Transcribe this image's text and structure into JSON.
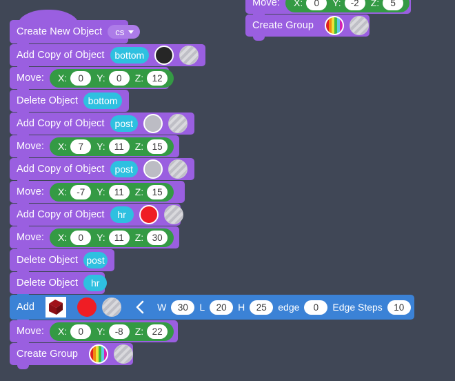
{
  "canvas": {
    "background_color": "#404756",
    "block_purple": "#9a5fe0",
    "block_blue": "#3b82d6",
    "capsule_green": "#349a44",
    "pill_cyan": "#2ec0e0"
  },
  "top_script": {
    "move": {
      "label": "Move:",
      "x_label": "X:",
      "x_value": "0",
      "y_label": "Y:",
      "y_value": "-2",
      "z_label": "Z:",
      "z_value": "5"
    },
    "create_group": {
      "label": "Create Group",
      "swatch_primary": "rainbow-swatch",
      "swatch_secondary": "striped-swatch"
    }
  },
  "main_script": {
    "create_new_object": {
      "label": "Create New Object",
      "dropdown_value": "cs",
      "dropdown_icon": "chevron-down-icon"
    },
    "rows": [
      {
        "type": "add-copy",
        "label": "Add Copy of Object",
        "object_name": "bottom",
        "swatch_primary": "black-swatch",
        "swatch_secondary": "striped-swatch"
      },
      {
        "type": "move",
        "label": "Move:",
        "x_label": "X:",
        "x_value": "0",
        "y_label": "Y:",
        "y_value": "0",
        "z_label": "Z:",
        "z_value": "12"
      },
      {
        "type": "delete",
        "label": "Delete Object",
        "object_name": "bottom"
      },
      {
        "type": "add-copy",
        "label": "Add Copy of Object",
        "object_name": "post",
        "swatch_primary": "grey-swatch",
        "swatch_secondary": "striped-swatch"
      },
      {
        "type": "move",
        "label": "Move:",
        "x_label": "X:",
        "x_value": "7",
        "y_label": "Y:",
        "y_value": "11",
        "z_label": "Z:",
        "z_value": "15"
      },
      {
        "type": "add-copy",
        "label": "Add Copy of Object",
        "object_name": "post",
        "swatch_primary": "grey-swatch",
        "swatch_secondary": "striped-swatch"
      },
      {
        "type": "move",
        "label": "Move:",
        "x_label": "X:",
        "x_value": "-7",
        "y_label": "Y:",
        "y_value": "11",
        "z_label": "Z:",
        "z_value": "15"
      },
      {
        "type": "add-copy",
        "label": "Add Copy of Object",
        "object_name": "hr",
        "swatch_primary": "red-swatch",
        "swatch_secondary": "striped-swatch"
      },
      {
        "type": "move",
        "label": "Move:",
        "x_label": "X:",
        "x_value": "0",
        "y_label": "Y:",
        "y_value": "11",
        "z_label": "Z:",
        "z_value": "30"
      },
      {
        "type": "delete",
        "label": "Delete Object",
        "object_name": "post"
      },
      {
        "type": "delete",
        "label": "Delete Object",
        "object_name": "hr"
      }
    ],
    "add_block": {
      "label": "Add",
      "shape_icon": "cube-icon",
      "swatch_primary": "red-swatch",
      "swatch_secondary": "striped-swatch",
      "prev_icon": "chevron-left-icon",
      "w_label": "W",
      "w_value": "30",
      "l_label": "L",
      "l_value": "20",
      "h_label": "H",
      "h_value": "25",
      "edge_label": "edge",
      "edge_value": "0",
      "edge_steps_label": "Edge Steps",
      "edge_steps_value": "10"
    },
    "final_move": {
      "label": "Move:",
      "x_label": "X:",
      "x_value": "0",
      "y_label": "Y:",
      "y_value": "-8",
      "z_label": "Z:",
      "z_value": "22"
    },
    "create_group": {
      "label": "Create Group",
      "swatch_primary": "rainbow-swatch",
      "swatch_secondary": "striped-swatch"
    }
  }
}
